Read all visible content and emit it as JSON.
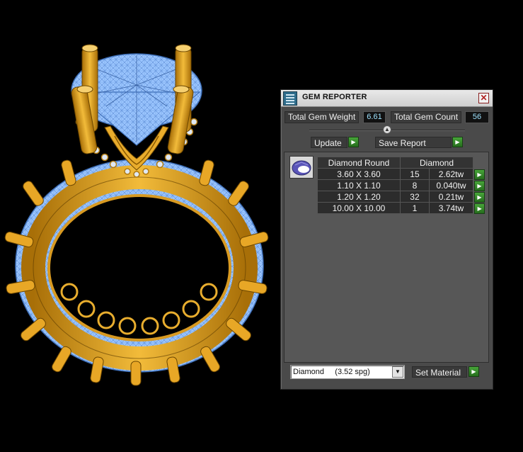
{
  "panel": {
    "title": "GEM REPORTER",
    "close_glyph": "✕",
    "total_weight_label": "Total Gem Weight",
    "total_weight_value": "6.61",
    "total_count_label": "Total Gem Count",
    "total_count_value": "56",
    "update_label": "Update",
    "save_report_label": "Save Report",
    "go_glyph": "▶",
    "table": {
      "header_shape": "Diamond Round",
      "header_material": "Diamond",
      "rows": [
        {
          "size": "3.60 X 3.60",
          "count": "15",
          "weight": "2.62tw"
        },
        {
          "size": "1.10 X 1.10",
          "count": "8",
          "weight": "0.040tw"
        },
        {
          "size": "1.20 X 1.20",
          "count": "32",
          "weight": "0.21tw"
        },
        {
          "size": "10.00 X 10.00",
          "count": "1",
          "weight": "3.74tw"
        }
      ]
    },
    "material_select_value": "Diamond     (3.52 spg)",
    "set_material_label": "Set Material"
  },
  "colors": {
    "gold_metal": "#e0a21f",
    "gem_wireframe": "#7fb4ff",
    "accent_green": "#3f9a2f",
    "value_text": "#9fe3ff"
  },
  "icons": [
    "gem-reporter-app-icon",
    "close-icon",
    "play-arrow-icon",
    "gem-thumbnail-icon",
    "dropdown-arrow-icon"
  ]
}
